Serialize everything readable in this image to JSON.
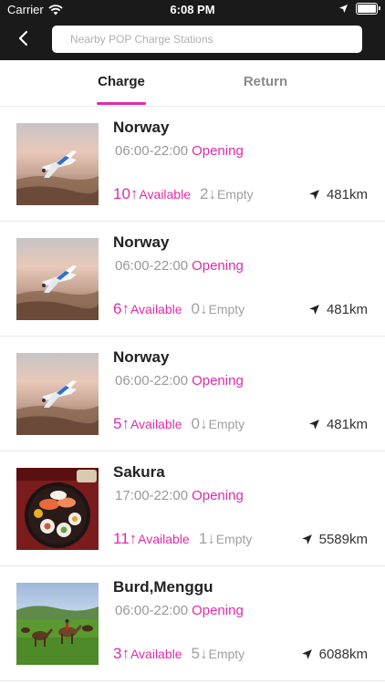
{
  "status_bar": {
    "carrier": "Carrier",
    "time": "6:08 PM",
    "icons": [
      "wifi-icon",
      "location-arrow-icon",
      "battery-icon"
    ]
  },
  "header": {
    "back_icon": "chevron-left-icon",
    "search_placeholder": "Nearby POP Charge Stations",
    "search_value": ""
  },
  "tabs": [
    {
      "label": "Charge",
      "active": true
    },
    {
      "label": "Return",
      "active": false
    }
  ],
  "colors": {
    "accent": "#e02ba8",
    "header_bg": "#1a1a1a",
    "muted_text": "#999999"
  },
  "stations": [
    {
      "name": "Norway",
      "hours": "06:00-22:00",
      "state": "Opening",
      "available": "10",
      "available_label": "Available",
      "empty": "2",
      "empty_label": "Empty",
      "distance": "481km",
      "image": "airplane-photo"
    },
    {
      "name": "Norway",
      "hours": "06:00-22:00",
      "state": "Opening",
      "available": "6",
      "available_label": "Available",
      "empty": "0",
      "empty_label": "Empty",
      "distance": "481km",
      "image": "airplane-photo"
    },
    {
      "name": "Norway",
      "hours": "06:00-22:00",
      "state": "Opening",
      "available": "5",
      "available_label": "Available",
      "empty": "0",
      "empty_label": "Empty",
      "distance": "481km",
      "image": "airplane-photo"
    },
    {
      "name": "Sakura",
      "hours": "17:00-22:00",
      "state": "Opening",
      "available": "11",
      "available_label": "Available",
      "empty": "1",
      "empty_label": "Empty",
      "distance": "5589km",
      "image": "sushi-photo"
    },
    {
      "name": "Burd,Menggu",
      "hours": "06:00-22:00",
      "state": "Opening",
      "available": "3",
      "available_label": "Available",
      "empty": "5",
      "empty_label": "Empty",
      "distance": "6088km",
      "image": "horses-photo"
    }
  ],
  "arrows": {
    "up": "↑",
    "down": "↓"
  }
}
